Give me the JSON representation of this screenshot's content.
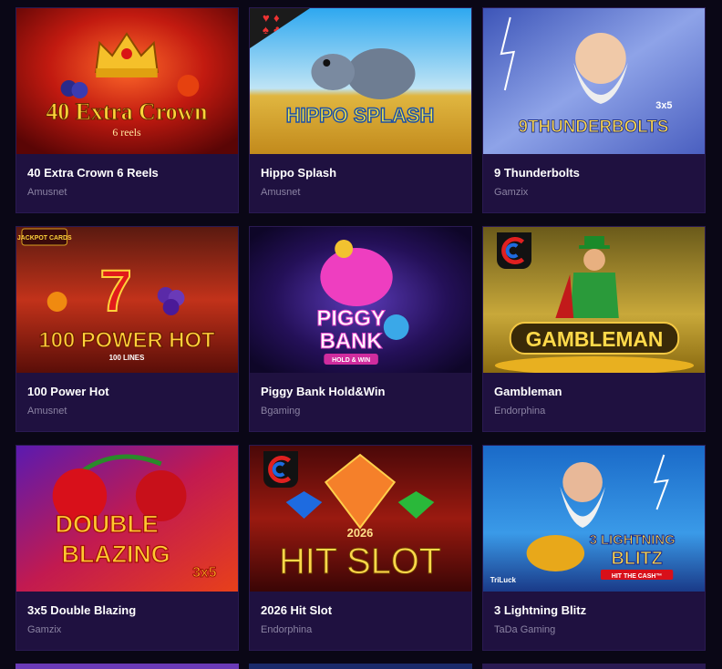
{
  "games": [
    {
      "title": "40 Extra Crown 6 Reels",
      "provider": "Amusnet",
      "art_title": "40 Extra Crown",
      "art_sub": "6 reels"
    },
    {
      "title": "Hippo Splash",
      "provider": "Amusnet",
      "art_title": "HIPPO SPLASH"
    },
    {
      "title": "9 Thunderbolts",
      "provider": "Gamzix",
      "art_title": "9THUNDERBOLTS",
      "art_sub": "3x5"
    },
    {
      "title": "100 Power Hot",
      "provider": "Amusnet",
      "art_title": "100 POWER HOT",
      "art_sub": "100 LINES",
      "art_badge": "JACKPOT CARDS"
    },
    {
      "title": "Piggy Bank Hold&Win",
      "provider": "Bgaming",
      "art_title": "PIGGY",
      "art_title2": "BANK",
      "art_sub": "HOLD & WIN"
    },
    {
      "title": "Gambleman",
      "provider": "Endorphina",
      "art_title": "GAMBLEMAN"
    },
    {
      "title": "3x5 Double Blazing",
      "provider": "Gamzix",
      "art_title": "DOUBLE",
      "art_title2": "BLAZING",
      "art_sub": "3x5"
    },
    {
      "title": "2026 Hit Slot",
      "provider": "Endorphina",
      "art_title": "HIT SLOT",
      "art_sub": "2026"
    },
    {
      "title": "3 Lightning Blitz",
      "provider": "TaDa Gaming",
      "art_title": "3 LIGHTNING",
      "art_title2": "BLITZ",
      "art_sub": "HIT THE CASH™",
      "art_badge": "TriLuck"
    }
  ],
  "colors": {
    "page_bg": "#0a0716",
    "card_bg": "#1f1140",
    "title": "#ffffff",
    "provider": "#8b83a3"
  }
}
